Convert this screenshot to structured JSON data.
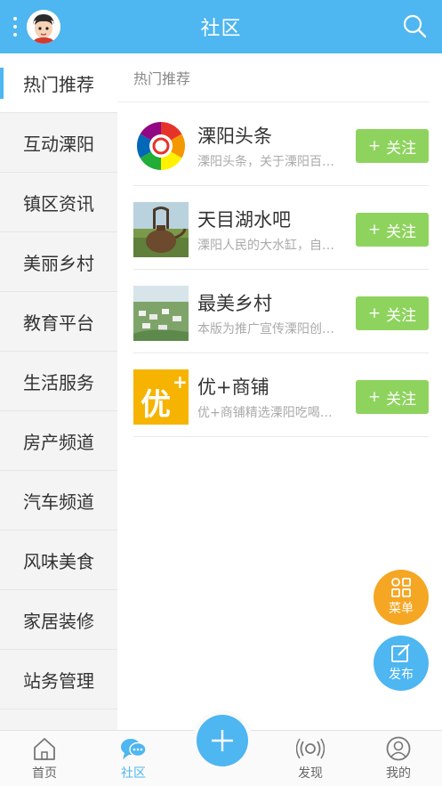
{
  "header": {
    "title": "社区"
  },
  "sidebar": {
    "items": [
      {
        "label": "热门推荐",
        "active": true
      },
      {
        "label": "互动溧阳"
      },
      {
        "label": "镇区资讯"
      },
      {
        "label": "美丽乡村"
      },
      {
        "label": "教育平台"
      },
      {
        "label": "生活服务"
      },
      {
        "label": "房产频道"
      },
      {
        "label": "汽车频道"
      },
      {
        "label": "风味美食"
      },
      {
        "label": "家居装修"
      },
      {
        "label": "站务管理"
      }
    ]
  },
  "main": {
    "section_title": "热门推荐",
    "follow_label": "关注",
    "follow_plus": "+",
    "items": [
      {
        "title": "溧阳头条",
        "desc": "溧阳头条，关于溧阳百…",
        "icon": "pinwheel-logo"
      },
      {
        "title": "天目湖水吧",
        "desc": "溧阳人民的大水缸，自…",
        "icon": "teapot-photo"
      },
      {
        "title": "最美乡村",
        "desc": "本版为推广宣传溧阳创…",
        "icon": "village-photo"
      },
      {
        "title": "优+商铺",
        "desc": "优+商铺精选溧阳吃喝…",
        "icon": "you-plus-logo",
        "logo_text": "优"
      }
    ]
  },
  "fabs": {
    "menu_label": "菜单",
    "post_label": "发布"
  },
  "bottom_nav": {
    "items": [
      {
        "label": "首页",
        "icon": "home-icon"
      },
      {
        "label": "社区",
        "icon": "community-icon",
        "active": true
      },
      {
        "label": "发现",
        "icon": "discover-icon"
      },
      {
        "label": "我的",
        "icon": "profile-icon"
      }
    ]
  },
  "colors": {
    "primary": "#4eb6f0",
    "follow": "#8ed35e",
    "menu_fab": "#f5a623"
  }
}
